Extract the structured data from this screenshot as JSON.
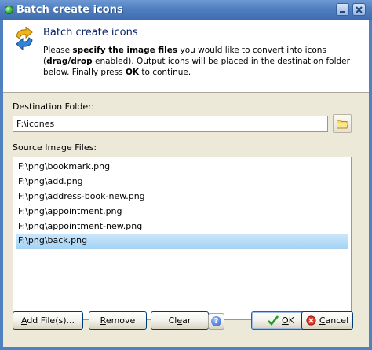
{
  "window": {
    "title": "Batch create icons"
  },
  "header": {
    "title": "Batch create icons",
    "desc_1": "Please ",
    "desc_bold_1": "specify the image files",
    "desc_2": " you would like to convert into icons (",
    "desc_bold_2": "drag/drop",
    "desc_3": " enabled). Output icons will be placed in the destination folder below. Finally press ",
    "desc_bold_3": "OK",
    "desc_4": " to continue."
  },
  "destination": {
    "label": "Destination Folder:",
    "value": "F:\\icones"
  },
  "source": {
    "label": "Source Image Files:",
    "files": [
      "F:\\png\\bookmark.png",
      "F:\\png\\add.png",
      "F:\\png\\address-book-new.png",
      "F:\\png\\appointment.png",
      "F:\\png\\appointment-new.png",
      "F:\\png\\back.png"
    ],
    "selected": "F:\\png\\back.png"
  },
  "buttons": {
    "add_pre": "A",
    "add_rest": "dd File(s)...",
    "remove_pre": "R",
    "remove_rest": "emove",
    "clear_pre": "Cl",
    "clear_u": "e",
    "clear_rest": "ar",
    "ok_u": "O",
    "ok_rest": "K",
    "cancel_u": "C",
    "cancel_rest": "ancel"
  },
  "icons": {
    "title": "green-dot-icon",
    "header": "convert-arrows-icon",
    "folder": "folder-icon",
    "help": "help-icon",
    "ok": "checkmark-icon",
    "cancel": "cancel-icon"
  }
}
